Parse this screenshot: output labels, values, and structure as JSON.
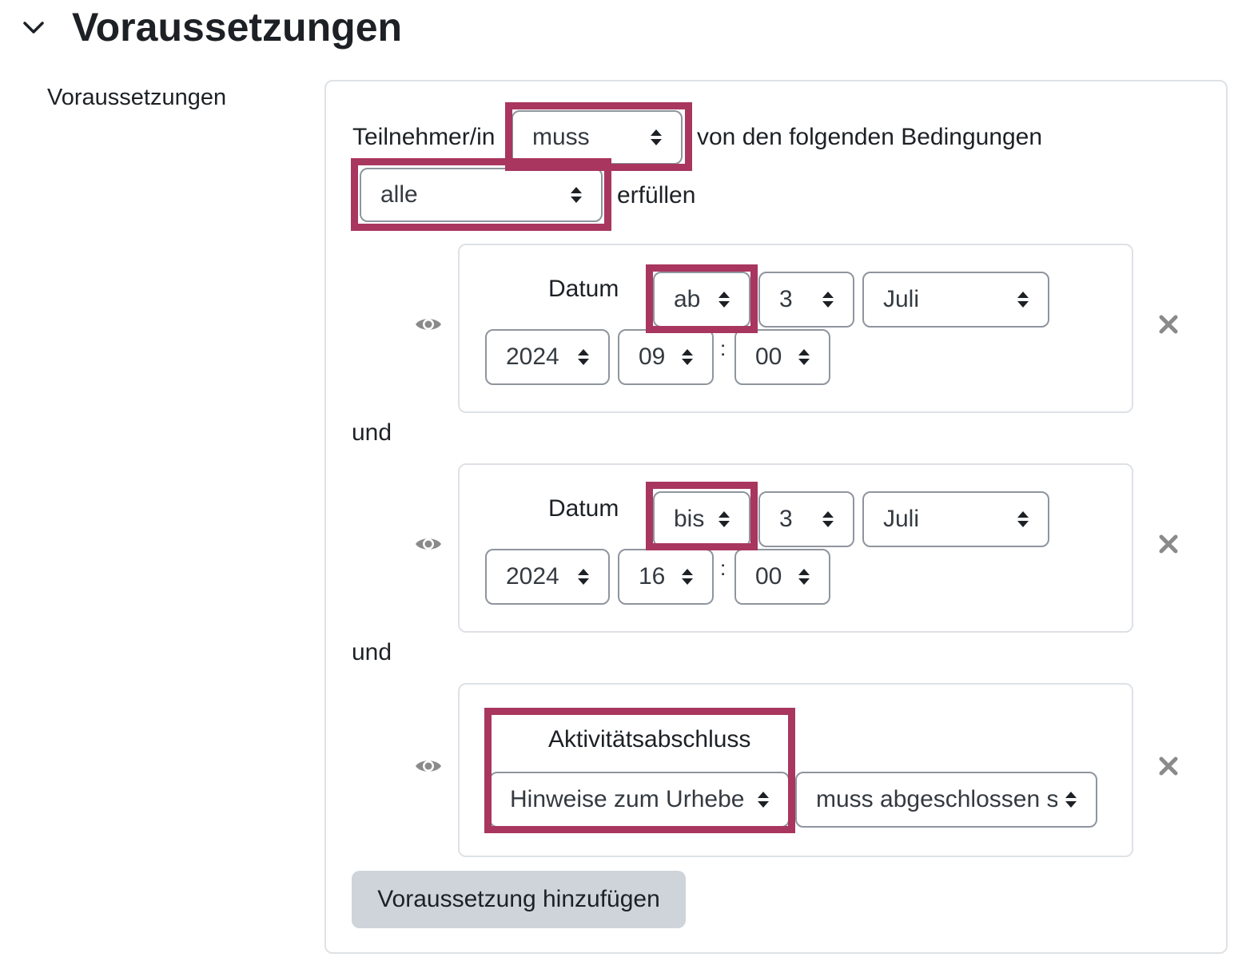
{
  "header": {
    "title": "Voraussetzungen",
    "collapse_icon": "chevron-down-icon"
  },
  "field": {
    "label": "Voraussetzungen"
  },
  "intro": {
    "prefix": "Teilnehmer/in",
    "must_select": "muss",
    "middle": "von den folgenden Bedingungen",
    "all_select": "alle",
    "suffix": "erfüllen"
  },
  "conditions": [
    {
      "type_label": "Datum",
      "direction": "ab",
      "day": "3",
      "month": "Juli",
      "year": "2024",
      "hour": "09",
      "minute": "00",
      "separator": ":",
      "visibility_icon": "eye-icon",
      "delete_icon": "close-icon"
    },
    {
      "type_label": "Datum",
      "direction": "bis",
      "day": "3",
      "month": "Juli",
      "year": "2024",
      "hour": "16",
      "minute": "00",
      "separator": ":",
      "visibility_icon": "eye-icon",
      "delete_icon": "close-icon"
    },
    {
      "type_label": "Aktivitätsabschluss",
      "activity": "Hinweise zum Urhebe",
      "state": "muss abgeschlossen s",
      "visibility_icon": "eye-icon",
      "delete_icon": "close-icon"
    }
  ],
  "connectors": [
    "und",
    "und"
  ],
  "add_button": "Voraussetzung hinzufügen",
  "colors": {
    "highlight": "#a8365e",
    "border": "#dee2e6",
    "control_border": "#8f959e",
    "button_bg": "#ced4da",
    "icon_gray": "#8a8a8a"
  }
}
